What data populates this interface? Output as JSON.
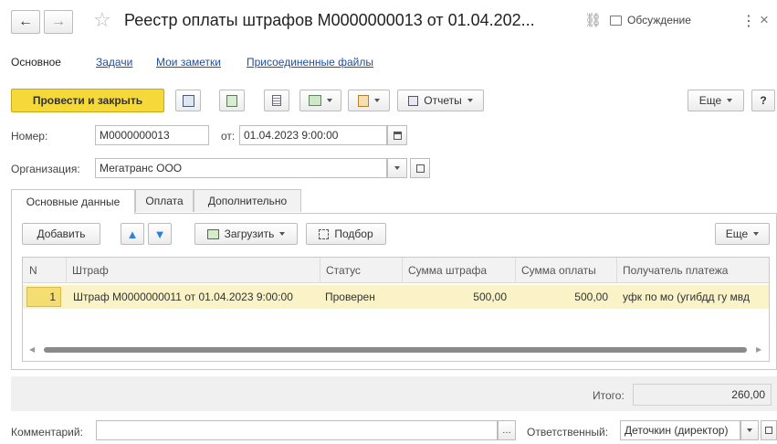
{
  "window": {
    "title": "Реестр оплаты штрафов М0000000013 от 01.04.202...",
    "discuss_label": "Обсуждение",
    "more_glyph": "⋮",
    "close_glyph": "×"
  },
  "nav_tabs": {
    "main": "Основное",
    "tasks": "Задачи",
    "notes": "Мои заметки",
    "files": "Присоединенные файлы"
  },
  "toolbar": {
    "post_close": "Провести и закрыть",
    "reports": "Отчеты",
    "more": "Еще",
    "help": "?"
  },
  "form": {
    "number_label": "Номер:",
    "number_value": "М0000000013",
    "from_label": "от:",
    "date_value": "01.04.2023  9:00:00",
    "org_label": "Организация:",
    "org_value": "Мегатранс ООО"
  },
  "sections": {
    "main": "Основные данные",
    "payment": "Оплата",
    "extra": "Дополнительно"
  },
  "table_toolbar": {
    "add": "Добавить",
    "load": "Загрузить",
    "select": "Подбор",
    "more": "Еще"
  },
  "table": {
    "columns": {
      "n": "N",
      "fine": "Штраф",
      "status": "Статус",
      "fine_sum": "Сумма штрафа",
      "paid_sum": "Сумма оплаты",
      "recipient": "Получатель платежа"
    },
    "rows": [
      {
        "n": "1",
        "fine": "Штраф М0000000011 от 01.04.2023 9:00:00",
        "status": "Проверен",
        "fine_sum": "500,00",
        "paid_sum": "500,00",
        "recipient": "уфк по мо (угибдд гу мвд"
      }
    ]
  },
  "footer": {
    "total_label": "Итого:",
    "total_value": "260,00",
    "comment_label": "Комментарий:",
    "comment_value": "",
    "responsible_label": "Ответственный:",
    "responsible_value": "Деточкин (директор)"
  },
  "colors": {
    "primary_button": "#f5d93a",
    "selected_row": "#faf3c8",
    "link": "#1f4e9c",
    "arrow_blue": "#2f7fd8"
  }
}
